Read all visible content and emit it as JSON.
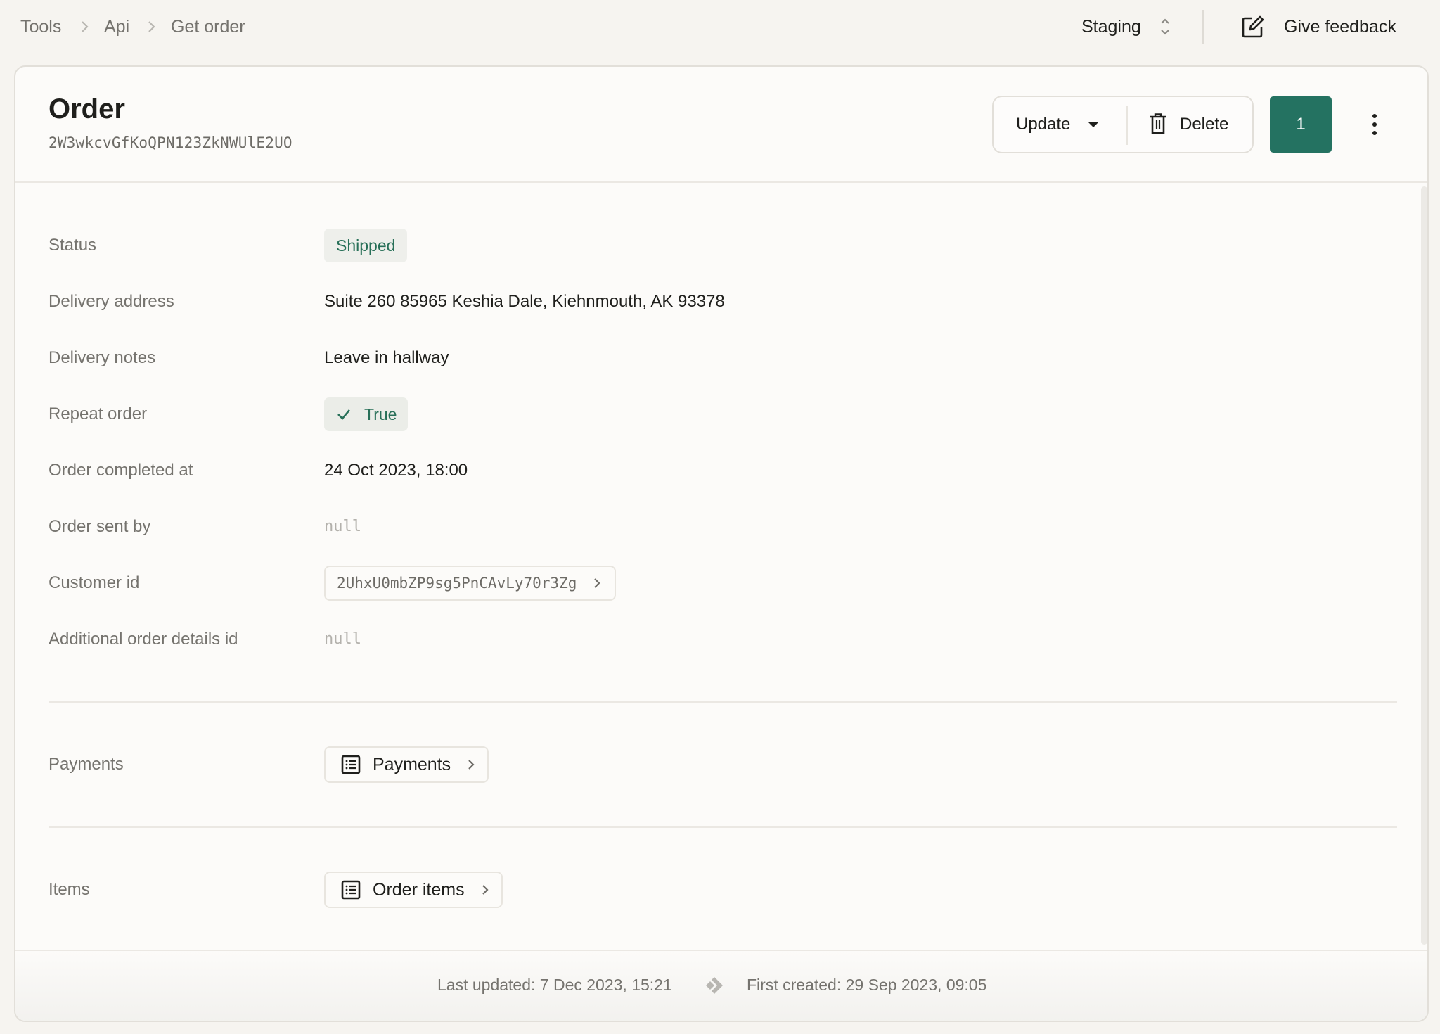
{
  "topbar": {
    "breadcrumb": [
      "Tools",
      "Api",
      "Get order"
    ],
    "environment": "Staging",
    "feedback_label": "Give feedback"
  },
  "header": {
    "title": "Order",
    "id": "2W3wkcvGfKoQPN123ZkNWUlE2UO",
    "update_label": "Update",
    "delete_label": "Delete",
    "counter": "1",
    "accent_color": "#247261"
  },
  "fields": [
    {
      "label": "Status",
      "value": "Shipped",
      "type": "badge"
    },
    {
      "label": "Delivery address",
      "value": "Suite 260 85965 Keshia Dale, Kiehnmouth, AK 93378",
      "type": "text"
    },
    {
      "label": "Delivery notes",
      "value": "Leave in hallway",
      "type": "text"
    },
    {
      "label": "Repeat order",
      "value": "True",
      "type": "boolean"
    },
    {
      "label": "Order completed at",
      "value": "24 Oct 2023, 18:00",
      "type": "datetime"
    },
    {
      "label": "Order sent by",
      "value": "null",
      "type": "null"
    },
    {
      "label": "Customer id",
      "value": "2UhxU0mbZP9sg5PnCAvLy70r3Zg",
      "type": "link"
    },
    {
      "label": "Additional order details id",
      "value": "null",
      "type": "null"
    }
  ],
  "relations": [
    {
      "label": "Payments",
      "button": "Payments"
    },
    {
      "label": "Items",
      "button": "Order items"
    }
  ],
  "footer": {
    "last_updated": "Last updated: 7 Dec 2023, 15:21",
    "first_created": "First created: 29 Sep 2023, 09:05"
  }
}
